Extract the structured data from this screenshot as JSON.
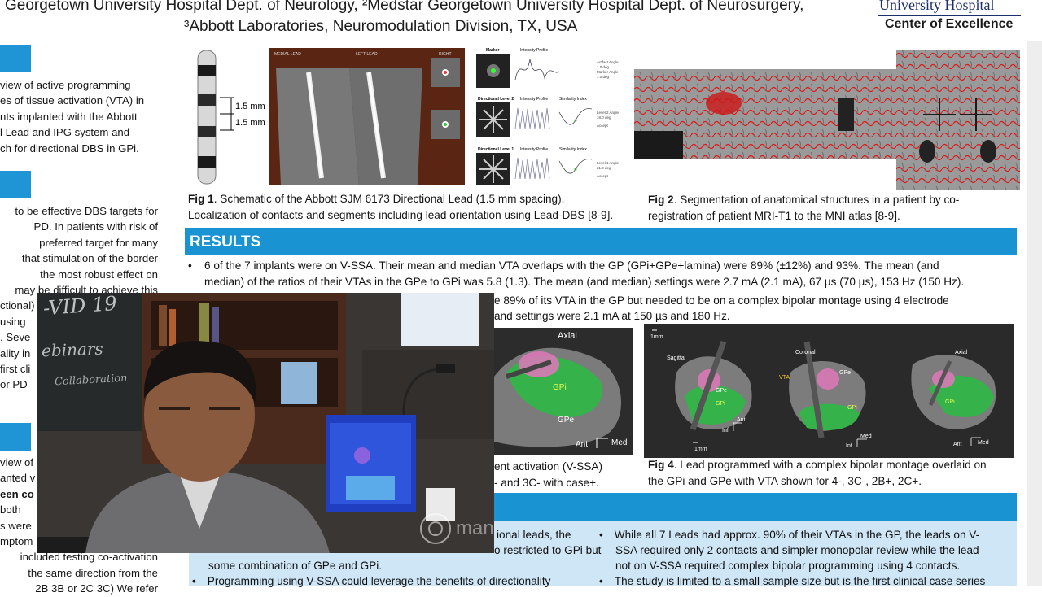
{
  "header": {
    "affiliations_line1": "Georgetown University Hospital Dept. of Neurology, ²Medstar Georgetown University Hospital Dept. of Neurosurgery,",
    "affiliations_line2": "³Abbott Laboratories, Neuromodulation Division, TX, USA",
    "logo_line": "University Hospital",
    "logo_subline": "Center of Excellence"
  },
  "left_column": {
    "block1": [
      "view of active programming",
      "es of tissue activation (VTA) in",
      "nts implanted with the Abbott",
      "l Lead and IPG system and",
      "ch for directional DBS in GPi."
    ],
    "block2": [
      "to be effective DBS targets for",
      "PD. In patients with risk of",
      "preferred target for many",
      "that stimulation of the border",
      "the most robust effect on",
      "may be difficult to achieve this",
      "ctional)",
      "using",
      ". Seve",
      "ality in",
      "first cli",
      "or PD"
    ],
    "block3": [
      "view of",
      "anted v",
      "een co",
      "both",
      "s were",
      "mptom",
      "included testing co-activation",
      "the same direction from the",
      "2B 3B or 2C 3C) We refer"
    ]
  },
  "figures": {
    "fig1_scale_a": "1.5 mm",
    "fig1_scale_b": "1.5 mm",
    "fig1_panel_left": "MEDIAL LEAD",
    "fig1_panel_mid": "LEFT LEAD",
    "fig1_panel_right": "RIGHT",
    "fig1_caption_label": "Fig 1",
    "fig1_caption_line1": ". Schematic of the Abbott SJM 6173 Directional Lead (1.5 mm spacing).",
    "fig1_caption_line2": "Localization of contacts and segments including lead orientation using Lead-DBS [8-9].",
    "plots": {
      "row1_label": "Marker",
      "row2_label": "Directional Level 2",
      "row3_label": "Directional Level 1",
      "col_intensity": "Intensity Profile",
      "col_similarity": "Similarity Index",
      "row1_notes": [
        "Artifact Angle",
        "1.0 deg",
        "Marker Angle",
        "1.0 deg"
      ],
      "row2_notes": [
        "Level 2 Angle",
        "18.0 deg",
        "",
        "Accept"
      ],
      "row3_notes": [
        "Level 1 Angle",
        "21.0 deg",
        "",
        "Accept"
      ]
    },
    "fig2_caption_label": "Fig 2",
    "fig2_caption_line1": ". Segmentation of anatomical structures in a patient by co-",
    "fig2_caption_line2": "registration of patient MRI-T1 to the MNI atlas [8-9]."
  },
  "results": {
    "title": "RESULTS",
    "bullet1_line1": "6 of the 7 implants were on V-SSA. Their mean and median VTA overlaps with the GP (GPi+GPe+lamina) were 89% (±12%) and 93%. The mean (and",
    "bullet1_line2": "median) of the ratios of their VTAs in the GPe to GPi was 5.8 (1.3). The mean (and median) settings were 2.7 mA (2.1 mA), 67 µs (70 µs), 153 Hz (150 Hz).",
    "bullet2_line1": "e 89% of its VTA in the GP but needed to be on a complex bipolar montage using 4 electrode",
    "bullet2_line2": "and settings were 2.1 mA at 150 µs and 180 Hz."
  },
  "fig3": {
    "axial": "Axial",
    "gpi": "GPi",
    "gpe": "GPe",
    "ant": "Ant",
    "med": "Med",
    "caption_line1": "ent activation (V-SSA)",
    "caption_line2": "- and 3C- with case+."
  },
  "fig4": {
    "scale_top": "1mm",
    "sagittal": "Sagittal",
    "coronal": "Coronal",
    "axial": "Axial",
    "vta": "VTA",
    "gpe": "GPe",
    "gpi_a": "GPi",
    "gpi_b": "GPi",
    "gpi_c": "GPi",
    "gpe_a": "GPe",
    "ant_a": "Ant",
    "inf_a": "Inf",
    "scale_bottom": "1mm",
    "med_b": "Med",
    "inf_b": "Inf",
    "ant_c": "Ant",
    "med_c": "Med",
    "caption_label": "Fig 4",
    "caption_line1": ". Lead programmed with a complex bipolar montage overlaid on",
    "caption_line2": "the GPi and GPe with VTA shown for 4-, 3C-, 2B+, 2C+."
  },
  "discussion": {
    "left_line1": "ional leads, the",
    "left_line2": "o restricted to GPi but",
    "left_line3": "some combination of GPe and GPi.",
    "left_line4": "Programming using V-SSA could leverage the benefits of directionality",
    "right_line1": "While all 7 Leads had approx. 90% of their VTAs in the GP, the leads on V-",
    "right_line2": "SSA required only 2 contacts and simpler monopolar review while the lead",
    "right_line3": "not on V-SSA required complex bipolar programming using 4 contacts.",
    "right_line4": "The study is limited to a small sample size but is the first clinical case series"
  },
  "webcam": {
    "chalk_title": "-VID 19",
    "chalk_line2": "ebinars",
    "chalk_line3": "Collaboration",
    "watermark": "manycam"
  },
  "colors": {
    "section_bar": "#1a93d3",
    "green_tissue": "#35b34a",
    "pink_vta": "#d979b6"
  }
}
